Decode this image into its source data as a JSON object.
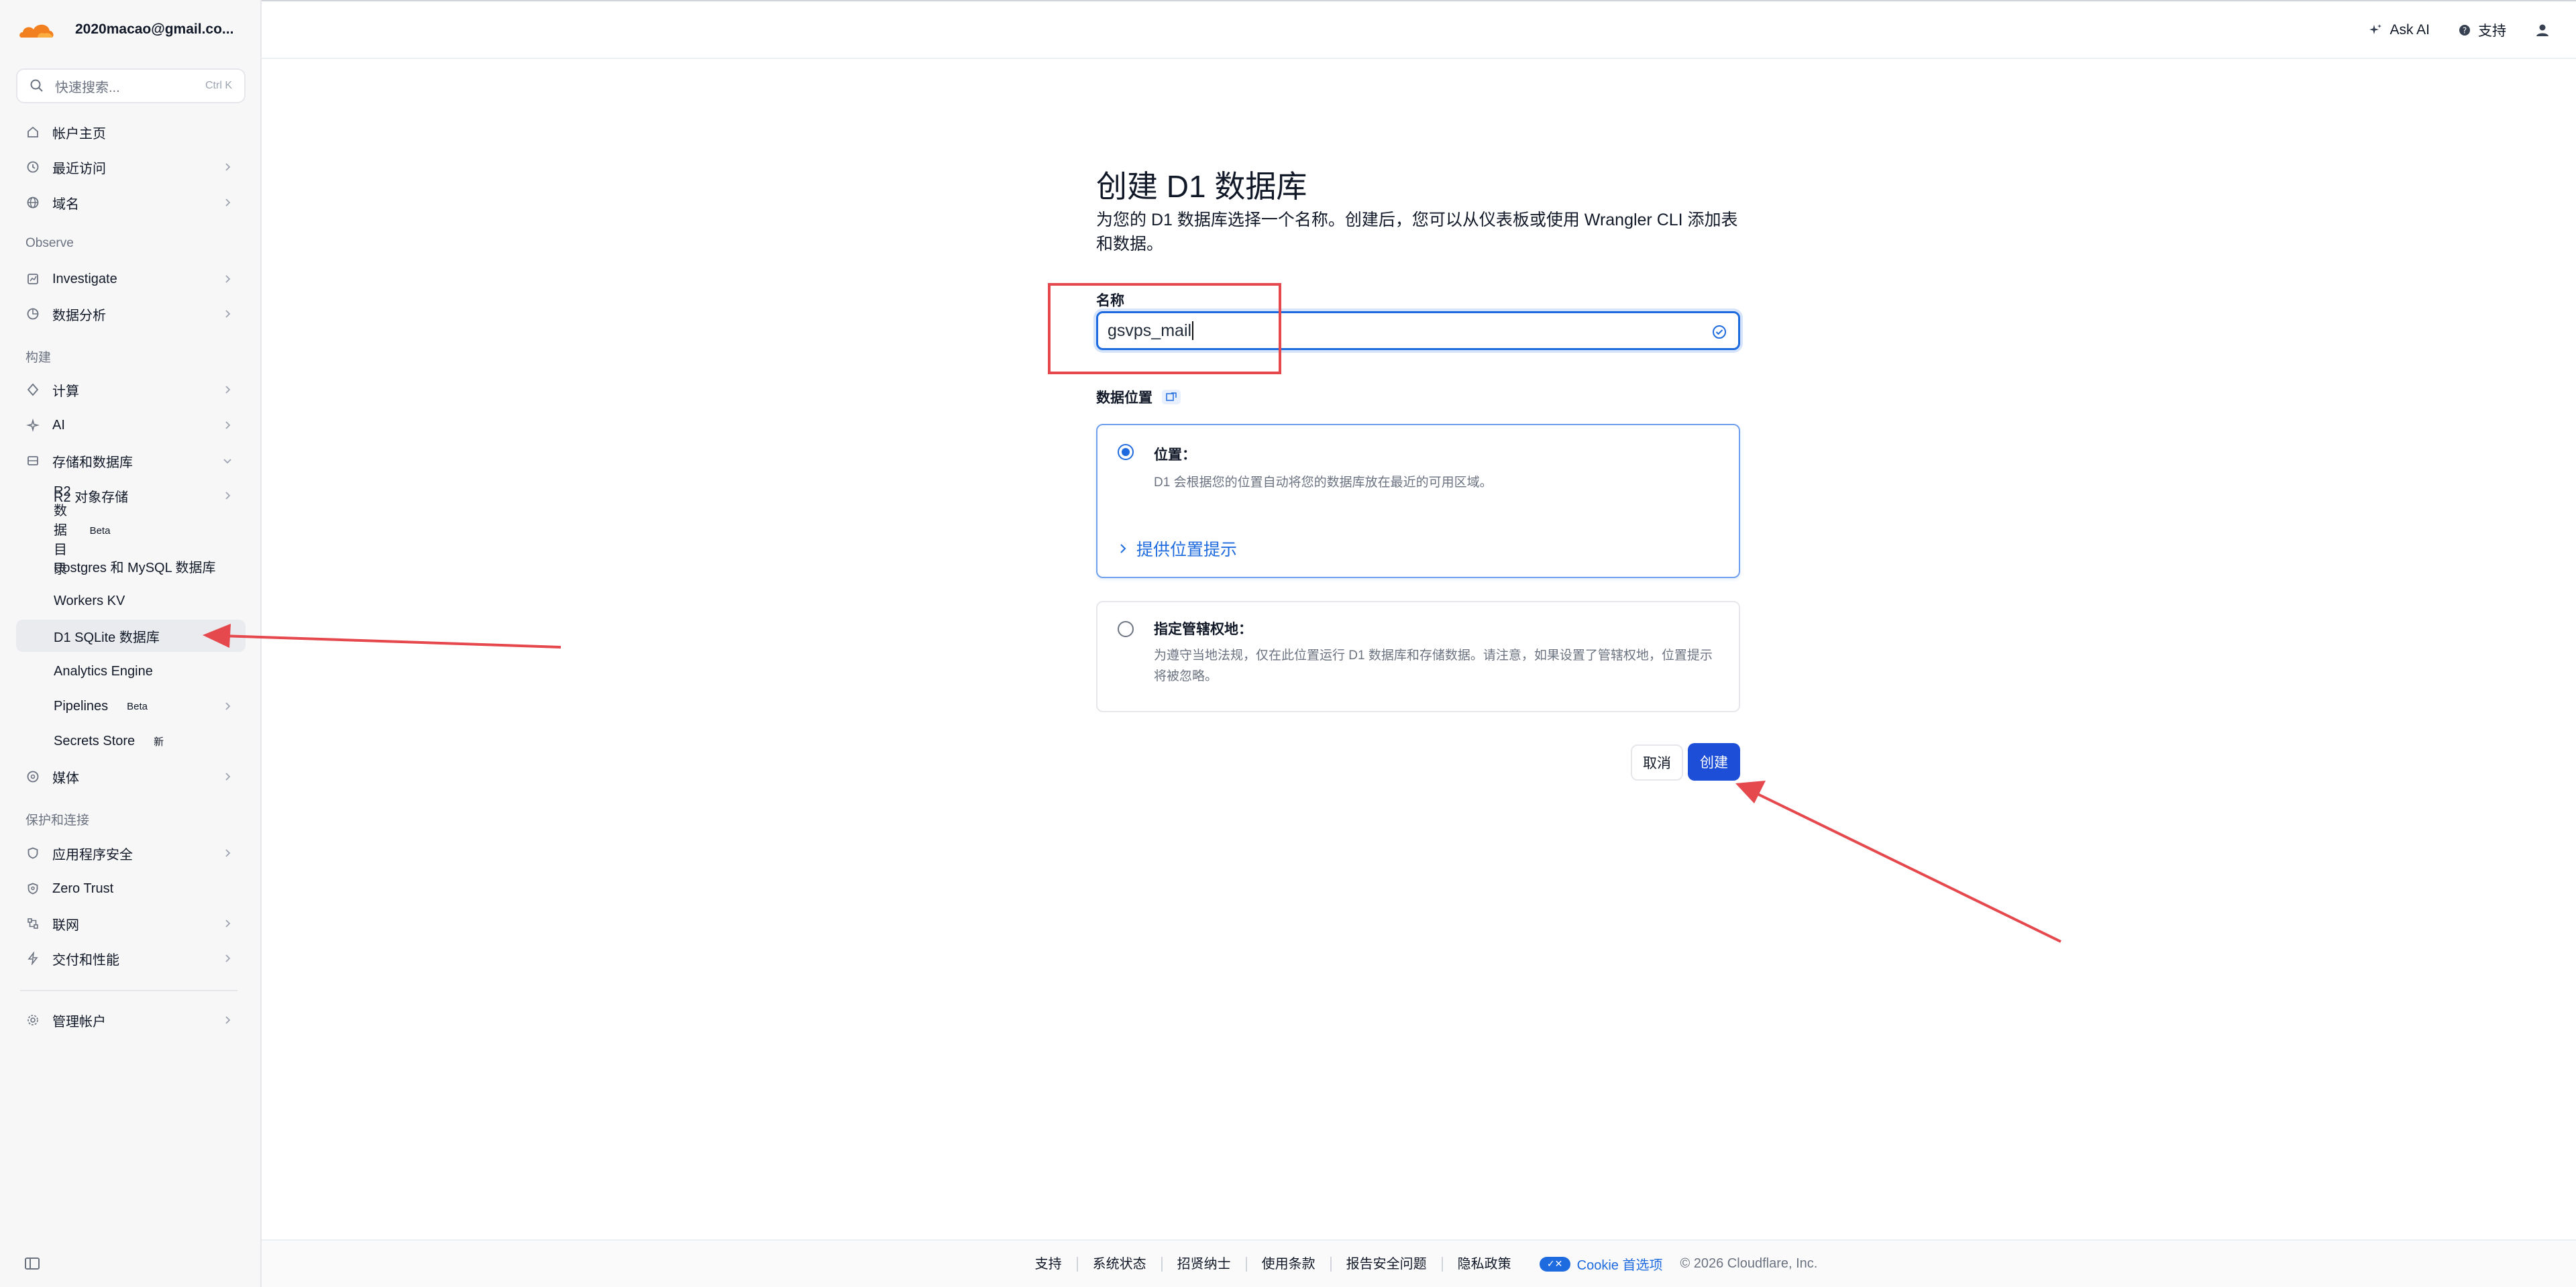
{
  "sidebar": {
    "account": "2020macao@gmail.co...",
    "search": {
      "placeholder": "快速搜索...",
      "shortcut": "Ctrl K"
    },
    "items": [
      {
        "label": "帐户主页",
        "icon": "home-icon"
      },
      {
        "label": "最近访问",
        "icon": "clock-icon"
      },
      {
        "label": "域名",
        "icon": "globe-icon"
      }
    ],
    "sections": [
      "Observe",
      "构建",
      "保护和连接"
    ],
    "observe": [
      {
        "label": "Investigate",
        "icon": "investigate-icon"
      },
      {
        "label": "数据分析",
        "icon": "chart-icon"
      }
    ],
    "build": [
      {
        "label": "计算",
        "icon": "compute-icon"
      },
      {
        "label": "AI",
        "icon": "ai-icon"
      },
      {
        "label": "存储和数据库",
        "icon": "storage-icon"
      }
    ],
    "storage_sub": [
      {
        "label": "R2 对象存储"
      },
      {
        "label": "R2 数据目录",
        "badge": "Beta"
      },
      {
        "label": "Postgres 和 MySQL 数据库"
      },
      {
        "label": "Workers KV"
      },
      {
        "label": "D1 SQLite 数据库"
      },
      {
        "label": "Analytics Engine"
      },
      {
        "label": "Pipelines",
        "badge": "Beta"
      },
      {
        "label": "Secrets Store",
        "badge": "新"
      }
    ],
    "media": {
      "label": "媒体",
      "icon": "media-icon"
    },
    "protect": [
      {
        "label": "应用程序安全",
        "icon": "shield-icon"
      },
      {
        "label": "Zero Trust",
        "icon": "zero-trust-icon"
      },
      {
        "label": "联网",
        "icon": "network-icon"
      },
      {
        "label": "交付和性能",
        "icon": "bolt-icon"
      }
    ],
    "manage": {
      "label": "管理帐户",
      "icon": "gear-icon"
    }
  },
  "topbar": {
    "ask_ai": "Ask AI",
    "support": "支持"
  },
  "main": {
    "title": "创建 D1 数据库",
    "description": "为您的 D1 数据库选择一个名称。创建后，您可以从仪表板或使用 Wrangler CLI 添加表和数据。",
    "name_label": "名称",
    "name_value": "gsvps_mail",
    "location_label": "数据位置",
    "option1": {
      "title": "位置：",
      "desc": "D1 会根据您的位置自动将您的数据库放在最近的可用区域。",
      "hint": "提供位置提示",
      "selected": true
    },
    "option2": {
      "title": "指定管辖权地：",
      "desc": "为遵守当地法规，仅在此位置运行 D1 数据库和存储数据。请注意，如果设置了管辖权地，位置提示将被忽略。",
      "selected": false
    },
    "cancel": "取消",
    "create": "创建"
  },
  "footer": {
    "links": [
      "支持",
      "系统状态",
      "招贤纳士",
      "使用条款",
      "报告安全问题",
      "隐私政策"
    ],
    "cookie": "Cookie 首选项",
    "copyright": "© 2026 Cloudflare, Inc."
  },
  "colors": {
    "accent": "#1e6adf",
    "primary_button": "#1d4ed8",
    "annotation": "#e5484d",
    "brand": "#f38020"
  }
}
